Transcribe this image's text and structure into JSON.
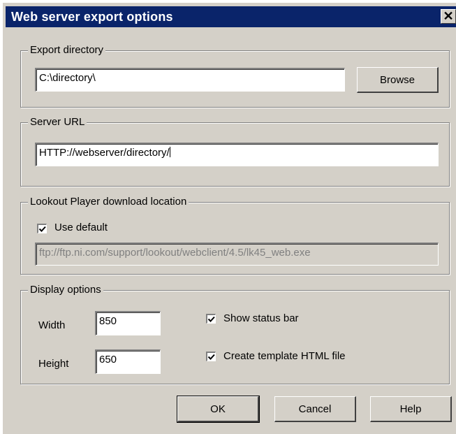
{
  "window": {
    "title": "Web server export options",
    "close_label": "✕"
  },
  "export_directory": {
    "legend": "Export directory",
    "value": "C:\\directory\\",
    "browse_label": "Browse"
  },
  "server_url": {
    "legend": "Server URL",
    "value": "HTTP://webserver/directory/"
  },
  "player_download": {
    "legend": "Lookout Player download location",
    "use_default_label": "Use default",
    "use_default_checked": true,
    "location_value": "ftp://ftp.ni.com/support/lookout/webclient/4.5/lk45_web.exe"
  },
  "display_options": {
    "legend": "Display options",
    "width_label": "Width",
    "width_value": "850",
    "height_label": "Height",
    "height_value": "650",
    "show_status_bar_label": "Show status bar",
    "show_status_bar_checked": true,
    "create_template_label": "Create template HTML file",
    "create_template_checked": true
  },
  "buttons": {
    "ok": "OK",
    "cancel": "Cancel",
    "help": "Help"
  },
  "colors": {
    "titlebar": "#0a246a",
    "face": "#d4d0c8"
  }
}
